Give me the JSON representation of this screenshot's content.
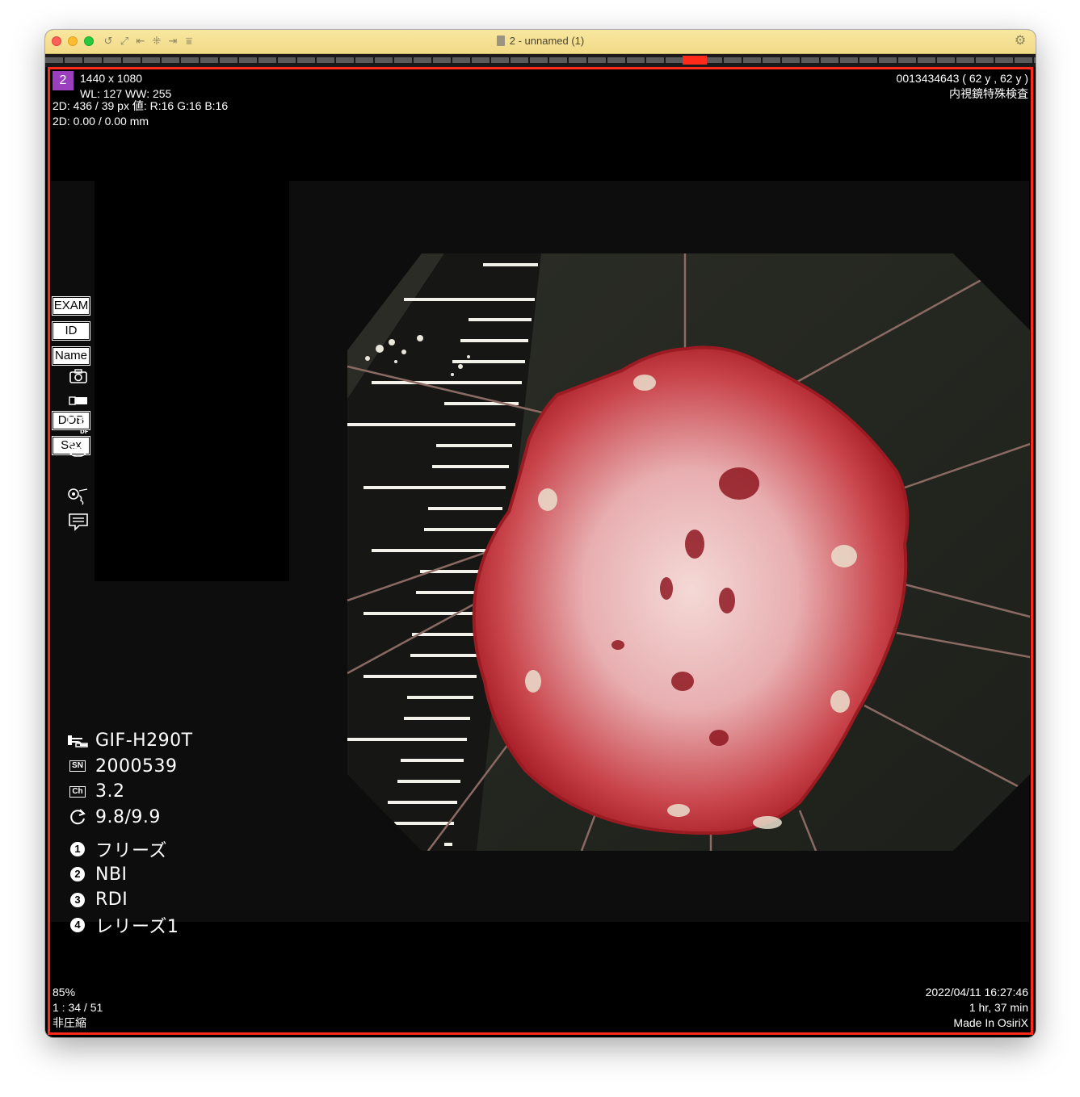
{
  "window": {
    "title": "2 - unnamed (1)"
  },
  "overlay": {
    "series_number": "2",
    "top_left": [
      "1440 x 1080",
      "WL: 127 WW: 255",
      "2D: 436 / 39 px 値: R:16 G:16 B:16",
      "2D: 0.00 / 0.00 mm"
    ],
    "top_right": [
      "0013434643 (  62 y ,  62 y )",
      "内視鏡特殊検査"
    ],
    "bottom_left": [
      "85%",
      "1 : 34 / 51",
      "非圧縮"
    ],
    "bottom_right": [
      "2022/04/11 16:27:46",
      "1 hr, 37 min",
      "Made In OsiriX"
    ]
  },
  "patient_labels": {
    "exam": "EXAM",
    "id": "ID",
    "name": "Name",
    "dob": "DOB",
    "sex": "Sex"
  },
  "scope_info": {
    "model": "GIF-H290T",
    "serial_badge": "SN",
    "serial": "2000539",
    "channel_badge": "Ch",
    "channel": "3.2",
    "ratio": "9.8/9.9"
  },
  "buttons": [
    {
      "num": "1",
      "label": "フリーズ"
    },
    {
      "num": "2",
      "label": "NBI"
    },
    {
      "num": "3",
      "label": "RDI"
    },
    {
      "num": "4",
      "label": "レリーズ1"
    }
  ],
  "colors": {
    "viewer_border": "#ff2a1a",
    "series_badge": "#9b3fbf",
    "titlebar": "#f4df8e"
  },
  "scrubber": {
    "position_fraction": 0.66
  }
}
